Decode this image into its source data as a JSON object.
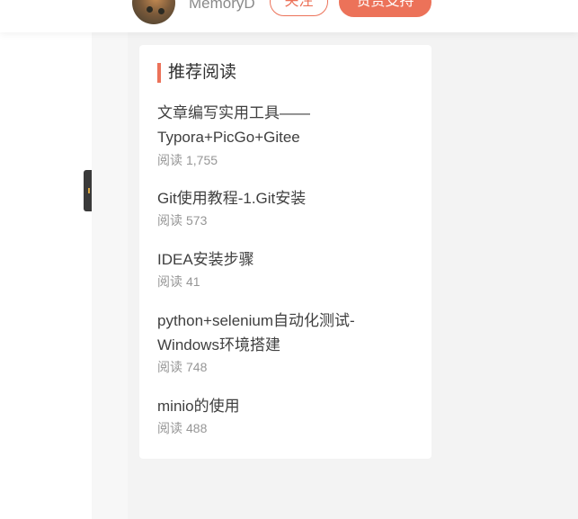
{
  "header": {
    "author_name": "MemoryD",
    "follow_label": "关注",
    "support_label": "赞赏支持"
  },
  "recommend": {
    "title": "推荐阅读",
    "read_label": "阅读",
    "items": [
      {
        "title_line1": "文章编写实用工具——",
        "title_line2": "Typora+PicGo+Gitee",
        "reads": "1,755"
      },
      {
        "title_line1": "Git使用教程-1.Git安装",
        "title_line2": "",
        "reads": "573"
      },
      {
        "title_line1": "IDEA安装步骤",
        "title_line2": "",
        "reads": "41"
      },
      {
        "title_line1": "python+selenium自动化测试-",
        "title_line2": "Windows环境搭建",
        "reads": "748"
      },
      {
        "title_line1": "minio的使用",
        "title_line2": "",
        "reads": "488"
      }
    ]
  },
  "colors": {
    "accent": "#ec7259",
    "page_bg": "#f3f3f3",
    "card_bg": "#ffffff",
    "meta_text": "#969696"
  },
  "icons": {
    "side_toggle": "side-toggle-icon"
  }
}
